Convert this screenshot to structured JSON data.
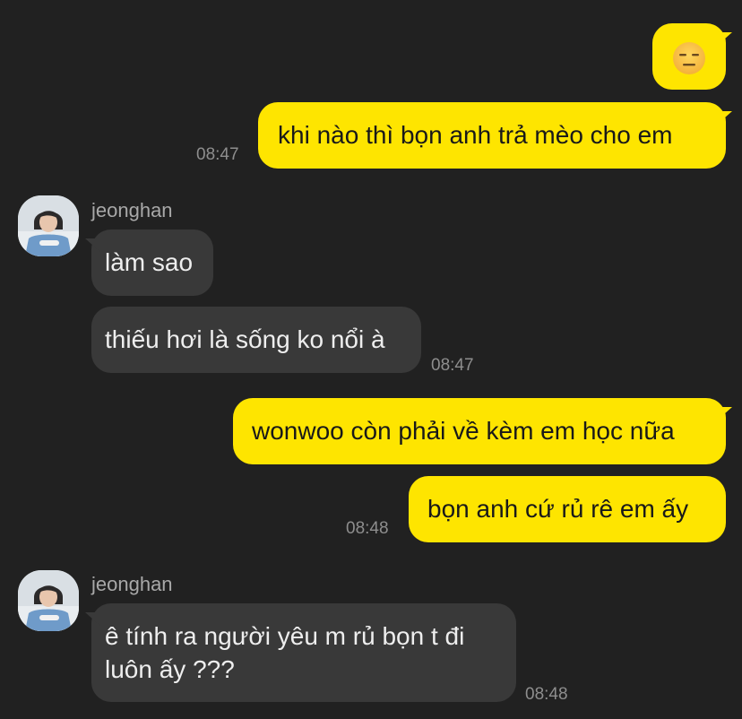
{
  "messages": {
    "m1": {
      "emoji_icon": "expressionless-face-emoji"
    },
    "m2": {
      "text": "khi nào thì bọn anh trả mèo cho em",
      "time": "08:47"
    },
    "group1": {
      "sender": "jeonghan",
      "m3": {
        "text": "làm sao"
      },
      "m4": {
        "text": "thiếu hơi là sống ko nổi à",
        "time": "08:47"
      }
    },
    "m5": {
      "text": "wonwoo còn phải về kèm em học nữa"
    },
    "m6": {
      "text": "bọn anh cứ rủ rê em ấy",
      "time": "08:48"
    },
    "group2": {
      "sender": "jeonghan",
      "m7": {
        "line1": "ê tính ra người yêu m rủ bọn t đi",
        "line2": "luôn ấy ???",
        "time": "08:48"
      }
    }
  },
  "colors": {
    "background": "#212121",
    "my_bubble": "#FEE500",
    "their_bubble": "#393939",
    "timestamp": "#8E8E8E",
    "sender_name": "#A8A8A8"
  }
}
